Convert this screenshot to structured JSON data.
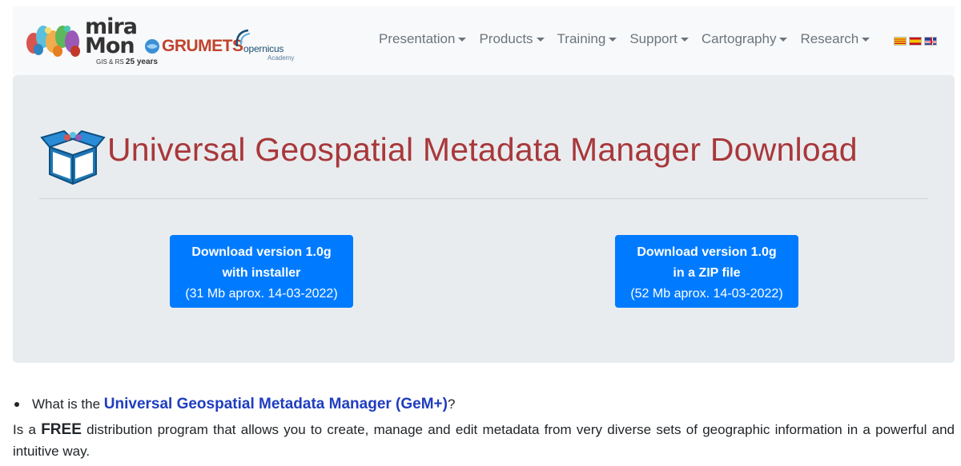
{
  "header": {
    "logos": {
      "miramon_word_1": "mira",
      "miramon_word_2": "Mon",
      "miramon_sub": "GIS & RS",
      "miramon_years": "25 years",
      "grumets": "GRUMETS",
      "copernicus": "opernicus",
      "copernicus_sub": "Academy"
    },
    "nav": [
      {
        "label": "Presentation"
      },
      {
        "label": "Products"
      },
      {
        "label": "Training"
      },
      {
        "label": "Support"
      },
      {
        "label": "Cartography"
      },
      {
        "label": "Research"
      }
    ],
    "languages": [
      "catalan-flag",
      "spanish-flag",
      "english-flag"
    ]
  },
  "jumbotron": {
    "title": "Universal Geospatial Metadata Manager Download",
    "buttons": [
      {
        "line1": "Download version 1.0g",
        "line2": "with installer",
        "line3": "(31 Mb aprox. 14-03-2022)"
      },
      {
        "line1": "Download version 1.0g",
        "line2": "in a ZIP file",
        "line3": "(52 Mb aprox. 14-03-2022)"
      }
    ]
  },
  "content": {
    "question_prefix": "What is the ",
    "question_link": "Universal Geospatial Metadata Manager (GeM+)",
    "question_suffix": "?",
    "desc_prefix": "Is a ",
    "desc_free": "FREE",
    "desc_rest": " distribution program that allows you to create, manage and edit metadata from very diverse sets of geographic information in a powerful and intuitive way."
  },
  "colors": {
    "title": "#a8383b",
    "button": "#007bff",
    "link": "#1f3dbf",
    "navbar_bg": "#f8f9fa",
    "jumbo_bg": "#e9ecef"
  }
}
